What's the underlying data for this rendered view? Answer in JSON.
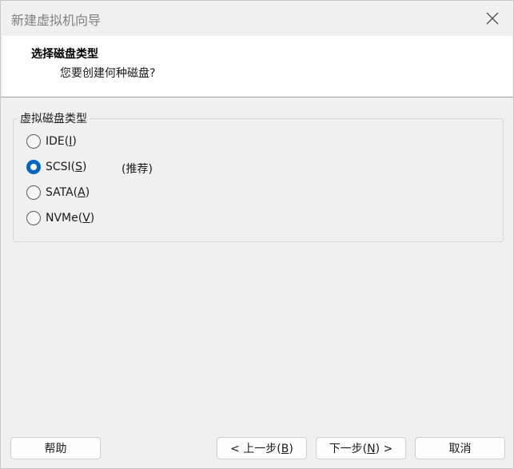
{
  "window": {
    "title": "新建虚拟机向导"
  },
  "header": {
    "title": "选择磁盘类型",
    "subtitle": "您要创建何种磁盘?"
  },
  "disk_type": {
    "group_label": "虚拟磁盘类型",
    "options": [
      {
        "label": "IDE(",
        "mnemonic": "I",
        "suffix": ")",
        "checked": false
      },
      {
        "label": "SCSI(",
        "mnemonic": "S",
        "suffix": ")",
        "checked": true
      },
      {
        "label": "SATA(",
        "mnemonic": "A",
        "suffix": ")",
        "checked": false
      },
      {
        "label": "NVMe(",
        "mnemonic": "V",
        "suffix": ")",
        "checked": false
      }
    ],
    "recommended_note": "(推荐)"
  },
  "buttons": {
    "help": "帮助",
    "back_prefix": "< 上一步(",
    "back_mnemonic": "B",
    "back_suffix": ")",
    "next_prefix": "下一步(",
    "next_mnemonic": "N",
    "next_suffix": ") >",
    "cancel": "取消"
  },
  "colors": {
    "accent": "#0067c0"
  },
  "icons": {
    "close": "close-icon"
  }
}
